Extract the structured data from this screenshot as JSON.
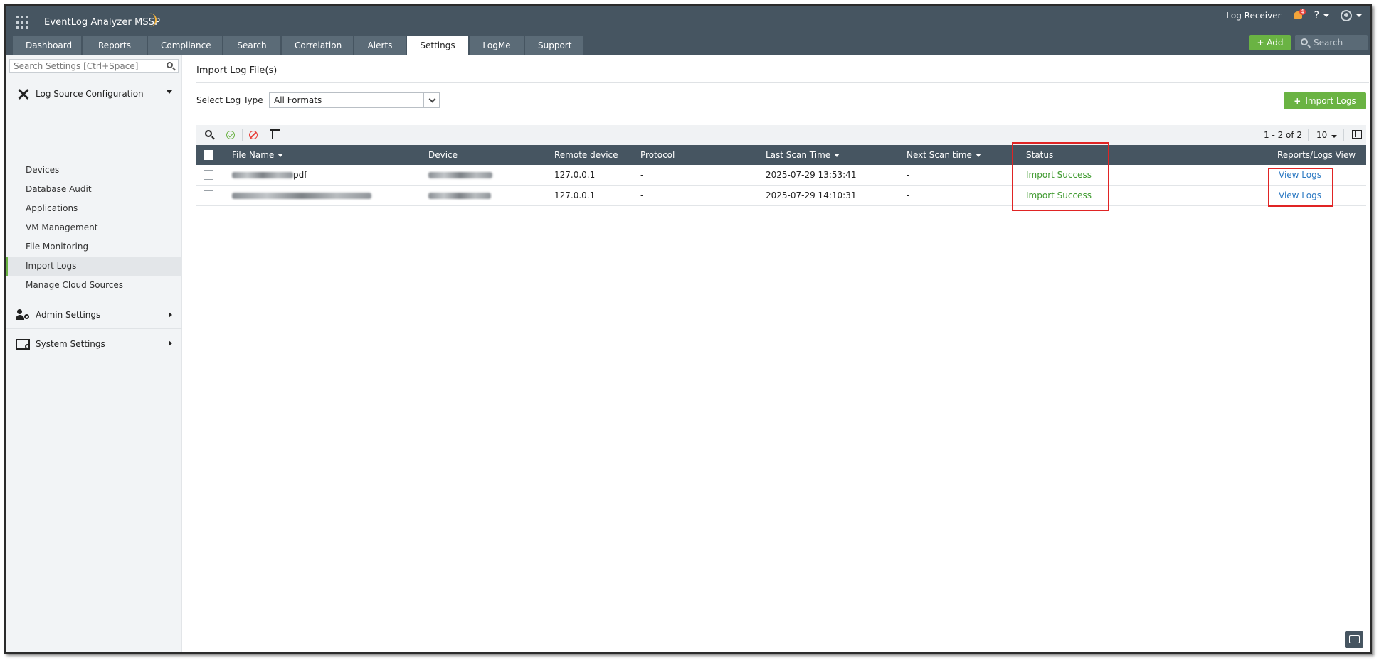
{
  "app": {
    "brand": "EventLog Analyzer MSSP",
    "log_receiver": "Log Receiver",
    "notification_count": "4",
    "help_label": "?",
    "add_label": "+ Add",
    "search_placeholder": "Search"
  },
  "tabs": [
    {
      "label": "Dashboard",
      "active": false
    },
    {
      "label": "Reports",
      "active": false
    },
    {
      "label": "Compliance",
      "active": false
    },
    {
      "label": "Search",
      "active": false
    },
    {
      "label": "Correlation",
      "active": false
    },
    {
      "label": "Alerts",
      "active": false
    },
    {
      "label": "Settings",
      "active": true
    },
    {
      "label": "LogMe",
      "active": false
    },
    {
      "label": "Support",
      "active": false
    }
  ],
  "sidebar": {
    "search_placeholder": "Search Settings [Ctrl+Space]",
    "sections": {
      "log_source": "Log Source Configuration",
      "admin": "Admin Settings",
      "system": "System Settings"
    },
    "items": [
      {
        "label": "Devices",
        "active": false
      },
      {
        "label": "Database Audit",
        "active": false
      },
      {
        "label": "Applications",
        "active": false
      },
      {
        "label": "VM Management",
        "active": false
      },
      {
        "label": "File Monitoring",
        "active": false
      },
      {
        "label": "Import Logs",
        "active": true
      },
      {
        "label": "Manage Cloud Sources",
        "active": false
      }
    ]
  },
  "main": {
    "title": "Import Log File(s)",
    "select_label": "Select Log Type",
    "select_value": "All Formats",
    "import_button": "Import Logs",
    "pager": "1 - 2 of 2",
    "per_page": "10",
    "columns": {
      "file_name": "File Name",
      "device": "Device",
      "remote_device": "Remote device",
      "protocol": "Protocol",
      "last_scan": "Last Scan Time",
      "next_scan": "Next Scan time",
      "status": "Status",
      "reports": "Reports/Logs View"
    },
    "rows": [
      {
        "file_suffix": "pdf",
        "remote": "127.0.0.1",
        "protocol": "-",
        "last_scan": "2025-07-29 13:53:41",
        "next_scan": "-",
        "status": "Import Success",
        "action": "View Logs"
      },
      {
        "file_suffix": "",
        "remote": "127.0.0.1",
        "protocol": "-",
        "last_scan": "2025-07-29 14:10:31",
        "next_scan": "-",
        "status": "Import Success",
        "action": "View Logs"
      }
    ]
  },
  "colors": {
    "header": "#465561",
    "accent_green": "#6ab343",
    "status_green": "#3f9a2f",
    "link_blue": "#2a78c2",
    "highlight_red": "#e02424"
  }
}
